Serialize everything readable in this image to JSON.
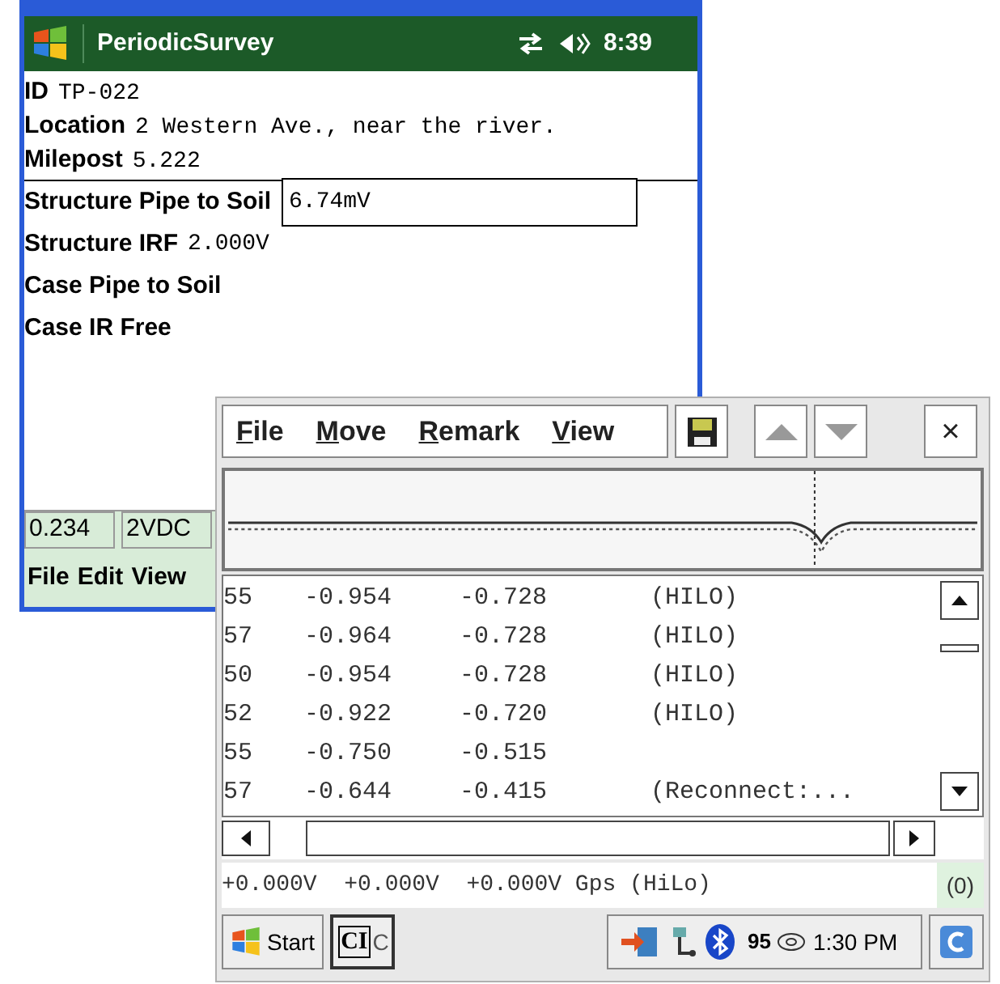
{
  "back_window": {
    "title": "PeriodicSurvey",
    "clock": "8:39",
    "fields": [
      {
        "label": "ID",
        "value": "TP-022"
      },
      {
        "label": "Location",
        "value": "2 Western Ave., near the river."
      },
      {
        "label": "Milepost",
        "value": "5.222"
      }
    ],
    "readings": [
      {
        "kind": "input",
        "label": "Structure Pipe to Soil",
        "value": "6.74mV"
      },
      {
        "kind": "text",
        "label": "Structure IRF",
        "value": "2.000V"
      },
      {
        "kind": "text",
        "label": "Case Pipe to Soil"
      },
      {
        "kind": "text",
        "label": "Case IR Free"
      }
    ],
    "status_cells": [
      "0.234",
      "2VDC"
    ],
    "menu": [
      "File",
      "Edit",
      "View"
    ]
  },
  "front_window": {
    "menu": [
      "File",
      "Move",
      "Remark",
      "View"
    ],
    "close": "×",
    "rows": [
      [
        "55",
        "-0.954",
        "-0.728",
        "(HILO)"
      ],
      [
        "57",
        "-0.964",
        "-0.728",
        "(HILO)"
      ],
      [
        "50",
        "-0.954",
        "-0.728",
        "(HILO)"
      ],
      [
        "52",
        "-0.922",
        "-0.720",
        "(HILO)"
      ],
      [
        "55",
        "-0.750",
        "-0.515"
      ],
      [
        "57",
        "-0.644",
        "-0.415",
        "(Reconnect:..."
      ]
    ],
    "status": "+0.000V  +0.000V  +0.000V Gps (HiLo)",
    "count": "(0)"
  },
  "taskbar": {
    "start": "Start",
    "task_icon": "CI",
    "task": "C",
    "tray_number": "95",
    "clock": "1:30 PM"
  }
}
